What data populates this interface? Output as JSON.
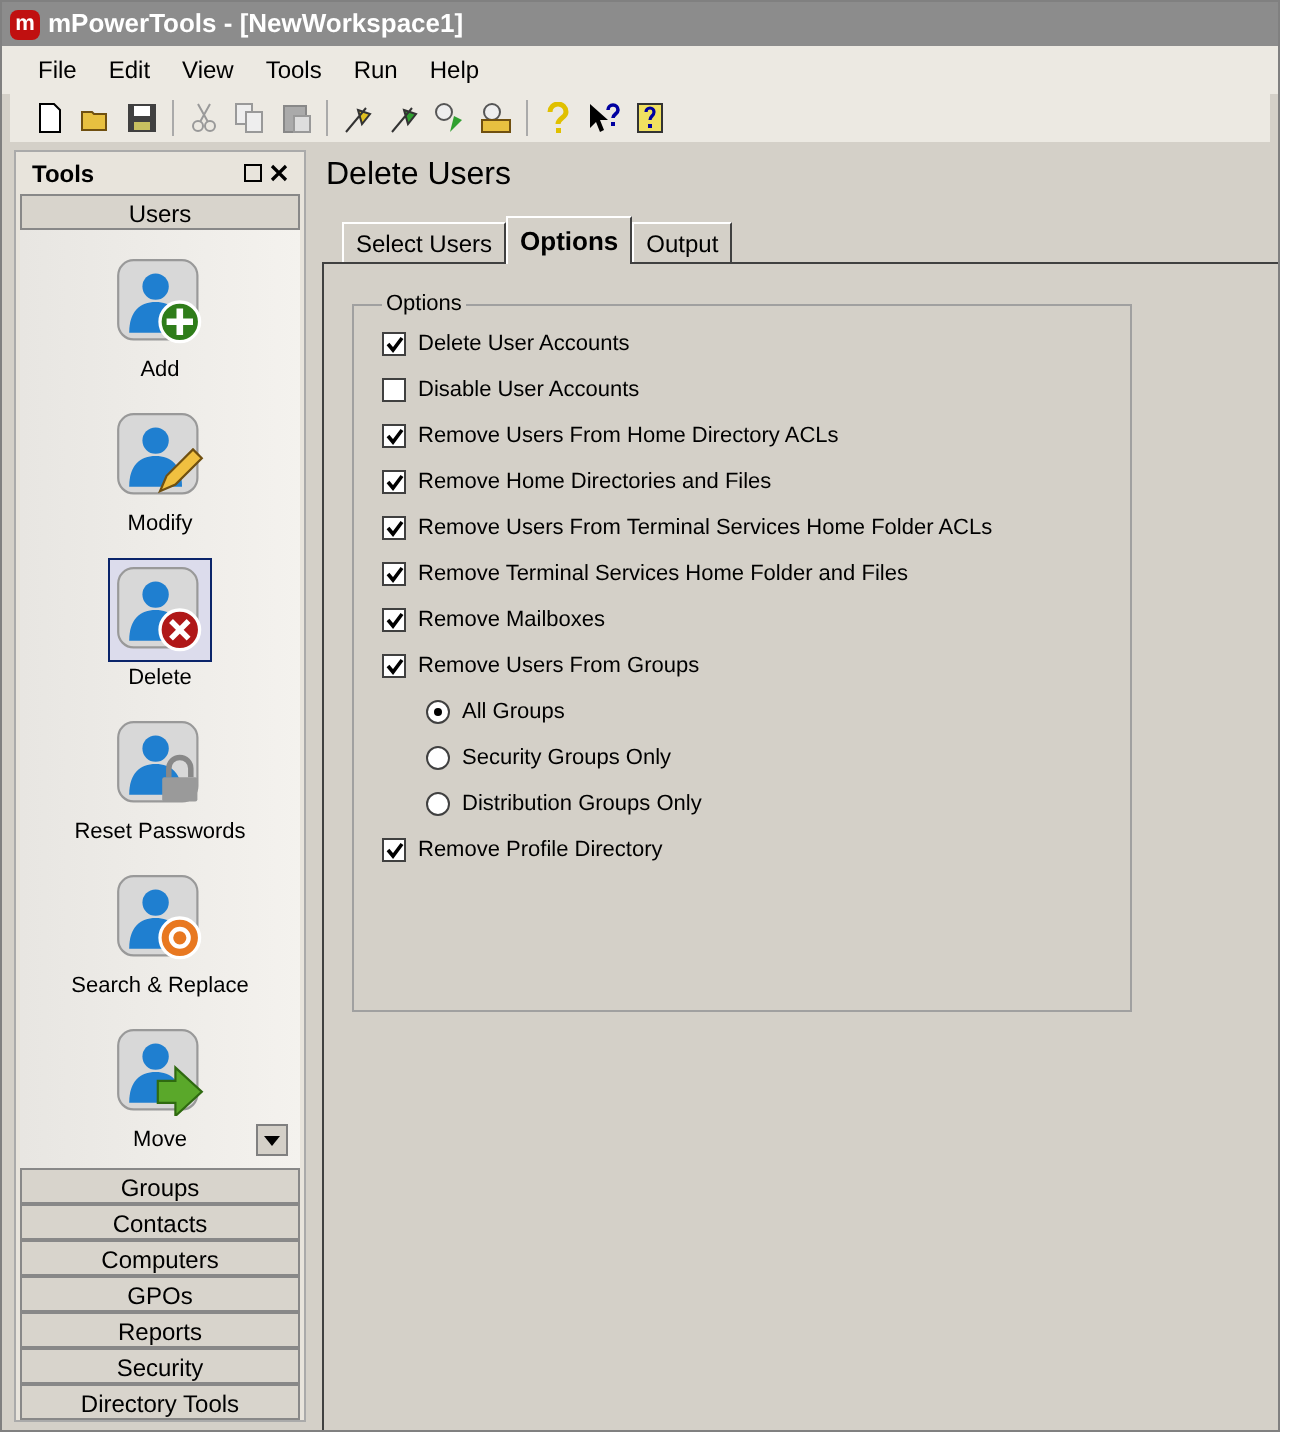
{
  "window": {
    "app_badge": "m",
    "title": "mPowerTools - [NewWorkspace1]"
  },
  "menu": [
    "File",
    "Edit",
    "View",
    "Tools",
    "Run",
    "Help"
  ],
  "tools_panel": {
    "title": "Tools",
    "active_category": "Users",
    "tools": [
      {
        "label": "Add",
        "kind": "add",
        "selected": false
      },
      {
        "label": "Modify",
        "kind": "modify",
        "selected": false
      },
      {
        "label": "Delete",
        "kind": "delete",
        "selected": true
      },
      {
        "label": "Reset Passwords",
        "kind": "lock",
        "selected": false
      },
      {
        "label": "Search & Replace",
        "kind": "replace",
        "selected": false
      },
      {
        "label": "Move",
        "kind": "move",
        "selected": false
      }
    ],
    "categories": [
      "Groups",
      "Contacts",
      "Computers",
      "GPOs",
      "Reports",
      "Security",
      "Directory Tools"
    ]
  },
  "page": {
    "title": "Delete Users",
    "tabs": [
      {
        "label": "Select Users",
        "selected": false
      },
      {
        "label": "Options",
        "selected": true
      },
      {
        "label": "Output",
        "selected": false
      }
    ],
    "group_title": "Options",
    "options": [
      {
        "label": "Delete User Accounts",
        "checked": true
      },
      {
        "label": "Disable User Accounts",
        "checked": false
      },
      {
        "label": "Remove Users From Home Directory ACLs",
        "checked": true
      },
      {
        "label": "Remove Home Directories and Files",
        "checked": true
      },
      {
        "label": "Remove Users From Terminal Services Home Folder ACLs",
        "checked": true
      },
      {
        "label": "Remove Terminal Services Home Folder and Files",
        "checked": true
      },
      {
        "label": "Remove Mailboxes",
        "checked": true
      },
      {
        "label": "Remove Users From Groups",
        "checked": true,
        "children": [
          {
            "label": "All Groups",
            "selected": true
          },
          {
            "label": "Security Groups Only",
            "selected": false
          },
          {
            "label": "Distribution Groups Only",
            "selected": false
          }
        ]
      },
      {
        "label": "Remove Profile Directory",
        "checked": true
      }
    ]
  }
}
